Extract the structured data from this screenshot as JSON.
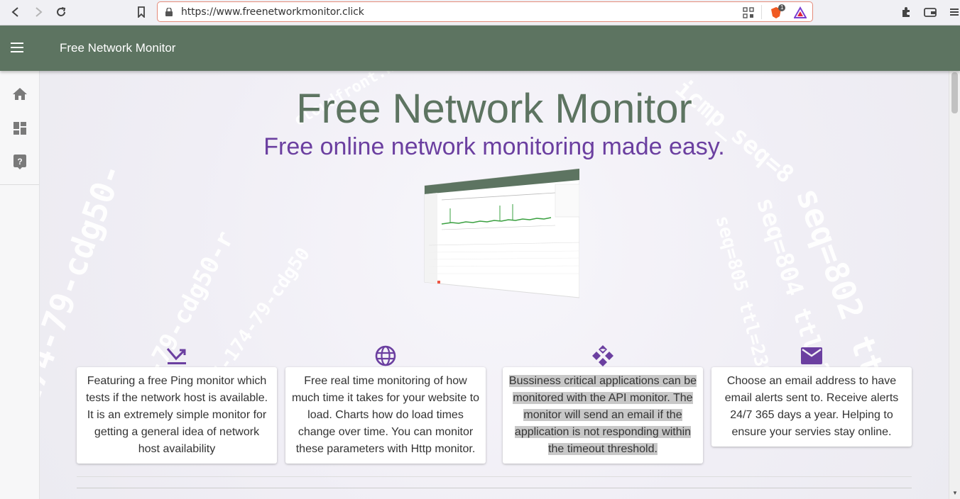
{
  "browser": {
    "url": "https://www.freenetworkmonitor.click",
    "brave_badge_count": "1"
  },
  "toolbar": {
    "title": "Free Network Monitor"
  },
  "sidenav": {
    "items": [
      "home-icon",
      "dashboard-icon",
      "help-icon"
    ]
  },
  "hero": {
    "title": "Free Network Monitor",
    "subtitle": "Free online network monitoring made easy."
  },
  "features": [
    {
      "icon": "ping-arrow-icon",
      "text": "Featuring a free Ping monitor which tests if the network host is available. It is an extremely simple monitor for getting a general idea of network host availability"
    },
    {
      "icon": "globe-icon",
      "text": "Free real time monitoring of how much time it takes for your website to load. Charts how do load times change over time. You can monitor these parameters with Http monitor."
    },
    {
      "icon": "api-icon",
      "text": "Bussiness critical applications can be monitored with the API monitor. The monitor will send an email if the application is not responding within the timeout threshold."
    },
    {
      "icon": "email-icon",
      "text": "Choose an email address to have email alerts sent to. Receive alerts 24/7 365 days a year. Helping to ensure your servies stay online."
    }
  ],
  "colors": {
    "toolbar": "#5d7461",
    "accent": "#6b3fa0"
  }
}
